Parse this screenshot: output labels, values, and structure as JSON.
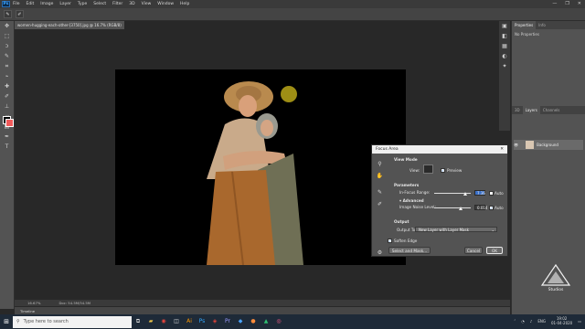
{
  "app": {
    "logo": "Ps"
  },
  "menu": [
    "File",
    "Edit",
    "Image",
    "Layer",
    "Type",
    "Select",
    "Filter",
    "3D",
    "View",
    "Window",
    "Help"
  ],
  "window_controls": [
    "—",
    "❐",
    "✕"
  ],
  "document": {
    "tab_title": "women-hugging-each-other-[3750].jpg @ 16.7% (RGB/8)",
    "zoom_status": "16.67%",
    "doc_status": "Doc: 54.5M/54.5M"
  },
  "timeline": {
    "label": "Timeline"
  },
  "colors": {
    "foreground": "#000000",
    "background": "#f05a5a",
    "accent": "#3a70c8"
  },
  "panels": {
    "top_tabs": [
      "Properties",
      "Info"
    ],
    "no_properties": "No Properties",
    "layer_tabs": [
      "3D",
      "Layers",
      "Channels"
    ],
    "layer_name": "Background"
  },
  "dialog": {
    "title": "Focus Area",
    "close": "✕",
    "view_mode": {
      "heading": "View Mode",
      "view_label": "View:",
      "preview_label": "Preview",
      "preview_checked": true
    },
    "parameters": {
      "heading": "Parameters",
      "in_focus_label": "In-Focus Range:",
      "in_focus_value": "7.36",
      "in_focus_level": 0.85,
      "auto_label": "Auto",
      "in_focus_auto": false,
      "advanced_label": "Advanced",
      "noise_label": "Image Noise Level:",
      "noise_value": "0.014",
      "noise_level": 0.72,
      "noise_auto": true
    },
    "output": {
      "heading": "Output",
      "output_to_label": "Output To:",
      "output_to_value": "New Layer with Layer Mask",
      "soften_label": "Soften Edge",
      "soften_checked": true
    },
    "buttons": {
      "select_mask": "Select and Mask...",
      "cancel": "Cancel",
      "ok": "OK"
    }
  },
  "taskbar": {
    "search_placeholder": "Type here to search",
    "time": "19:02",
    "date": "01-04-2020",
    "lang": "ENG"
  },
  "watermark": {
    "text": "Studios"
  }
}
